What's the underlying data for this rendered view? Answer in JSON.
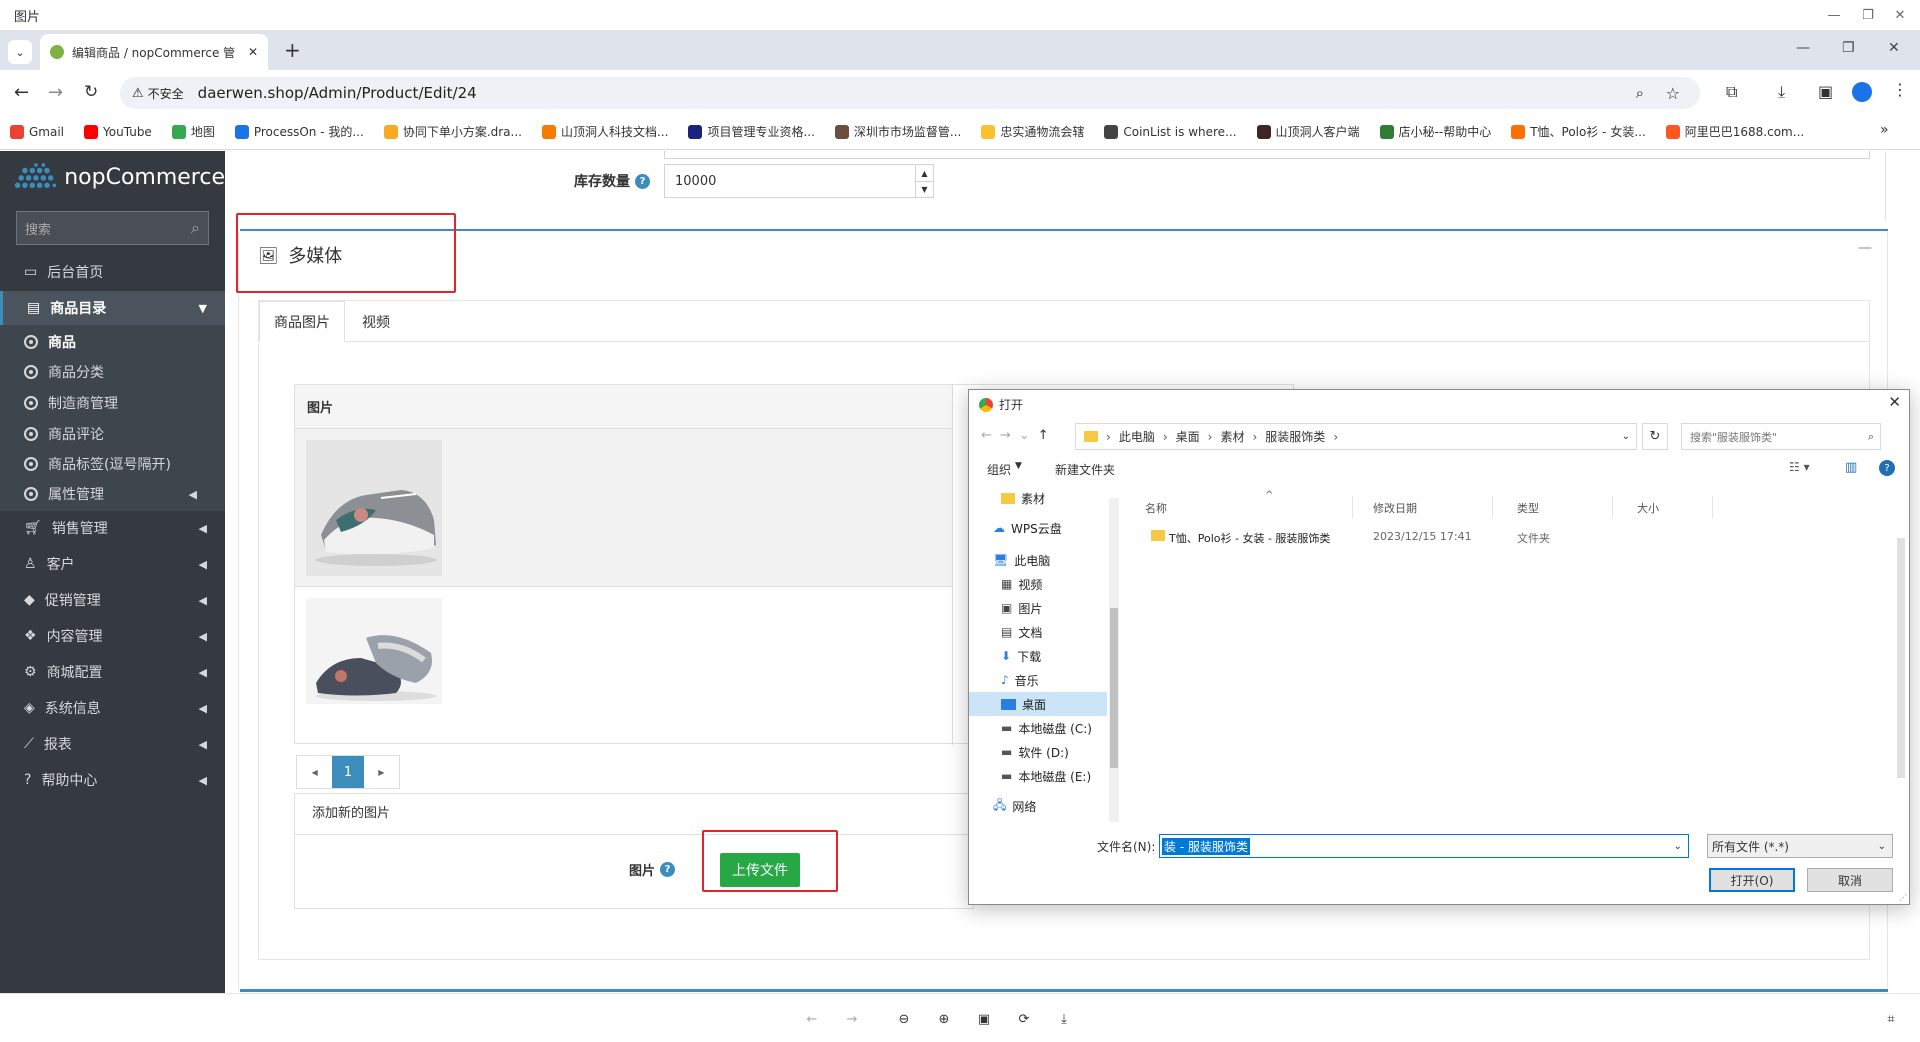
{
  "viewer": {
    "title": "图片"
  },
  "browser": {
    "tab_title": "编辑商品 / nopCommerce 管",
    "security": "不安全",
    "url": "daerwen.shop/Admin/Product/Edit/24",
    "bookmarks": [
      {
        "label": "Gmail",
        "color": "#ea4335"
      },
      {
        "label": "YouTube",
        "color": "#ff0000"
      },
      {
        "label": "地图",
        "color": "#34a853"
      },
      {
        "label": "ProcessOn - 我的...",
        "color": "#1a73e8"
      },
      {
        "label": "协同下单小方案.dra...",
        "color": "#f9a825"
      },
      {
        "label": "山顶洞人科技文档...",
        "color": "#f57c00"
      },
      {
        "label": "项目管理专业资格...",
        "color": "#1a237e"
      },
      {
        "label": "深圳市市场监督管...",
        "color": "#6d4c41"
      },
      {
        "label": "忠实通物流会辖",
        "color": "#fbc02d"
      },
      {
        "label": "CoinList is where...",
        "color": "#444444"
      },
      {
        "label": "山顶洞人客户端",
        "color": "#3e2723"
      },
      {
        "label": "店小秘--帮助中心",
        "color": "#2e7d32"
      },
      {
        "label": "T恤、Polo衫 - 女装...",
        "color": "#ff6f00"
      },
      {
        "label": "阿里巴巴1688.com...",
        "color": "#ff5722"
      }
    ]
  },
  "sidebar": {
    "brand": "nopCommerce",
    "search_placeholder": "搜索",
    "items": [
      {
        "label": "后台首页"
      },
      {
        "label": "商品目录"
      },
      {
        "label": "销售管理"
      },
      {
        "label": "客户"
      },
      {
        "label": "促销管理"
      },
      {
        "label": "内容管理"
      },
      {
        "label": "商城配置"
      },
      {
        "label": "系统信息"
      },
      {
        "label": "报表"
      },
      {
        "label": "帮助中心"
      }
    ],
    "subitems": [
      {
        "label": "商品"
      },
      {
        "label": "商品分类"
      },
      {
        "label": "制造商管理"
      },
      {
        "label": "商品评论"
      },
      {
        "label": "商品标签(逗号隔开)"
      },
      {
        "label": "属性管理"
      }
    ]
  },
  "main": {
    "stock_label": "库存数量",
    "stock_value": "10000",
    "section_title": "多媒体",
    "tabs": [
      {
        "label": "商品图片"
      },
      {
        "label": "视频"
      }
    ],
    "pictures_header": "图片",
    "page_number": "1",
    "add_new_picture": "添加新的图片",
    "picture_label": "图片",
    "upload_button": "上传文件"
  },
  "dialog": {
    "title": "打开",
    "path": [
      "此电脑",
      "桌面",
      "素材",
      "服装服饰类"
    ],
    "search_placeholder": "搜索\"服装服饰类\"",
    "organize": "组织",
    "new_folder": "新建文件夹",
    "tree": [
      {
        "label": "素材"
      },
      {
        "label": "WPS云盘"
      },
      {
        "label": "此电脑"
      },
      {
        "label": "视频"
      },
      {
        "label": "图片"
      },
      {
        "label": "文档"
      },
      {
        "label": "下载"
      },
      {
        "label": "音乐"
      },
      {
        "label": "桌面"
      },
      {
        "label": "本地磁盘 (C:)"
      },
      {
        "label": "软件 (D:)"
      },
      {
        "label": "本地磁盘 (E:)"
      },
      {
        "label": "网络"
      }
    ],
    "columns": {
      "name": "名称",
      "date": "修改日期",
      "type": "类型",
      "size": "大小"
    },
    "files": [
      {
        "name": "T恤、Polo衫 - 女装 - 服装服饰类",
        "date": "2023/12/15 17:41",
        "type": "文件夹"
      }
    ],
    "filename_label": "文件名(N):",
    "filename_value": "装 - 服装服饰类",
    "filter": "所有文件 (*.*)",
    "open_button": "打开(O)",
    "cancel_button": "取消"
  }
}
